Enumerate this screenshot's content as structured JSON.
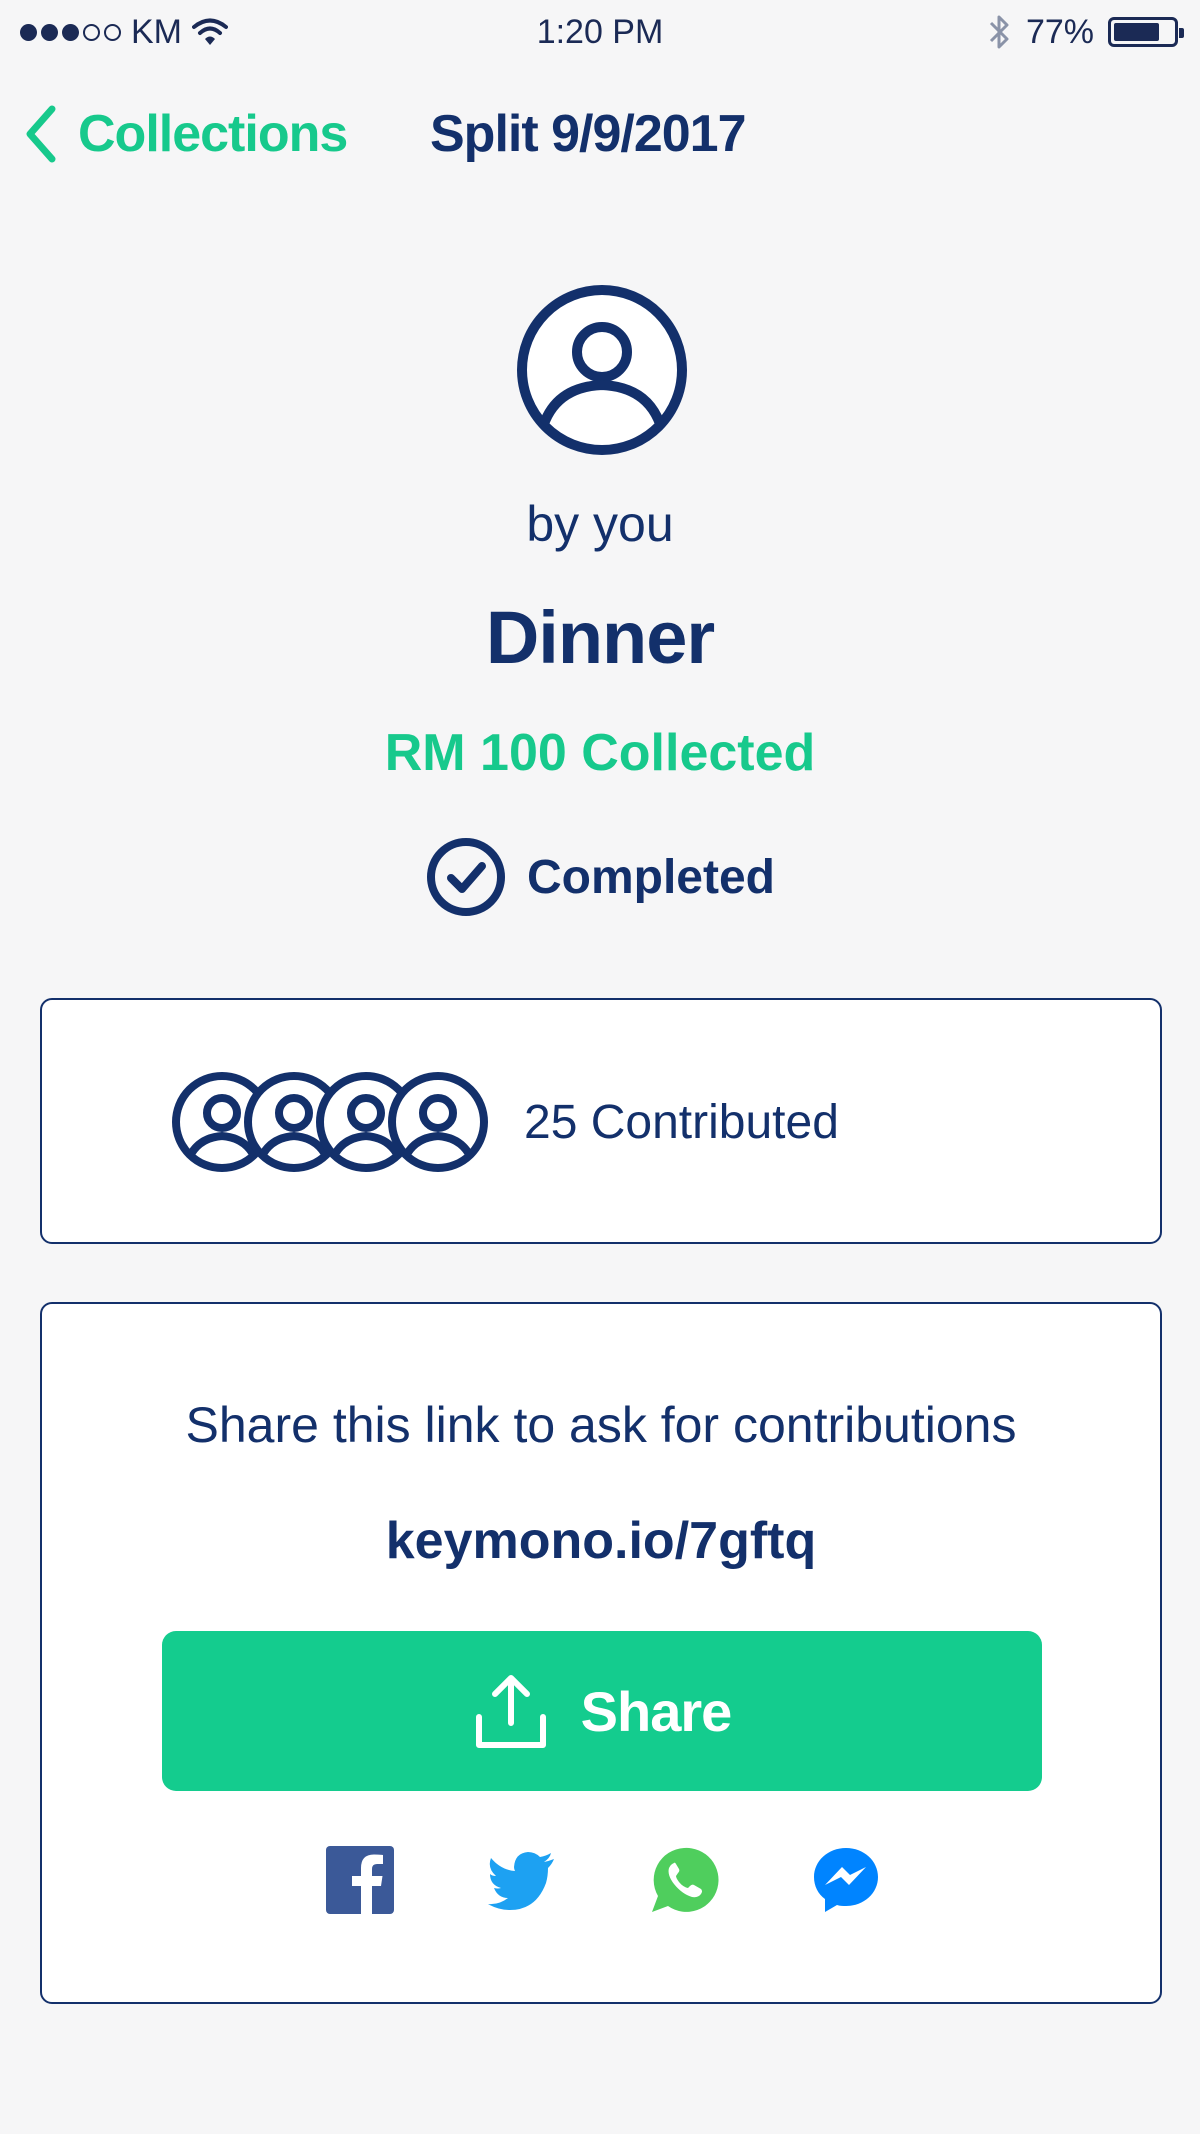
{
  "status_bar": {
    "carrier": "KM",
    "time": "1:20 PM",
    "battery": "77%",
    "battery_level": 0.77
  },
  "nav": {
    "back_label": "Collections",
    "title": "Split 9/9/2017"
  },
  "header": {
    "byline": "by you",
    "title": "Dinner",
    "collected": "RM 100 Collected",
    "status": "Completed"
  },
  "contributors": {
    "text": "25 Contributed"
  },
  "share": {
    "prompt": "Share this link to ask for contributions",
    "link": "keymono.io/7gftq",
    "button_label": "Share",
    "socials": [
      "facebook-icon",
      "twitter-icon",
      "whatsapp-icon",
      "messenger-icon"
    ]
  },
  "colors": {
    "brand_green": "#17c98c",
    "navy": "#13306b"
  }
}
